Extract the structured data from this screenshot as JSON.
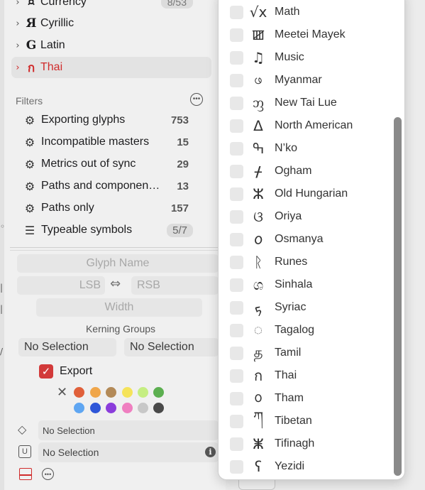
{
  "categories": [
    {
      "icon": "¤",
      "label": "Currency",
      "count": "8/53"
    },
    {
      "icon": "Я",
      "label": "Cyrillic"
    },
    {
      "icon": "G",
      "label": "Latin"
    },
    {
      "icon": "ก",
      "label": "Thai"
    }
  ],
  "filters": {
    "title": "Filters",
    "items": [
      {
        "label": "Exporting glyphs",
        "count": "753"
      },
      {
        "label": "Incompatible masters",
        "count": "15"
      },
      {
        "label": "Metrics out of sync",
        "count": "29"
      },
      {
        "label": "Paths and componen…",
        "count": "13"
      },
      {
        "label": "Paths only",
        "count": "157"
      },
      {
        "label": "Typeable symbols",
        "count": "5/7"
      }
    ]
  },
  "glyph_info": {
    "glyph_name_placeholder": "Glyph Name",
    "lsb_placeholder": "LSB",
    "rsb_placeholder": "RSB",
    "width_placeholder": "Width",
    "kerning_title": "Kerning Groups",
    "kerning_left": "No Selection",
    "kerning_right": "No Selection",
    "export_label": "Export",
    "tags_value": "No Selection",
    "unicode_value": "No Selection"
  },
  "colors": {
    "accent": "#d02b2b",
    "swatches": [
      "#e0603a",
      "#f0a64a",
      "#b38a58",
      "#f5e35a",
      "#c5ee82",
      "#5caf50",
      "#5fa6f2",
      "#2e56d8",
      "#8b3ddb",
      "#ef7fc0",
      "#c8c8c8",
      "#4a4a4a"
    ]
  },
  "scripts": [
    {
      "glyph": "√x",
      "label": "Math"
    },
    {
      "glyph": "ꯀ",
      "label": "Meetei Mayek"
    },
    {
      "glyph": "♫",
      "label": "Music"
    },
    {
      "glyph": "ဖ",
      "label": "Myanmar"
    },
    {
      "glyph": "ᦀ",
      "label": "New Tai Lue"
    },
    {
      "glyph": "ᐃ",
      "label": "North American"
    },
    {
      "glyph": "ߒ",
      "label": "N’ko"
    },
    {
      "glyph": "ᚋ",
      "label": "Ogham"
    },
    {
      "glyph": "ⵣ",
      "label": "Old Hungarian"
    },
    {
      "glyph": "ଓ",
      "label": "Oriya"
    },
    {
      "glyph": "𐒆",
      "label": "Osmanya"
    },
    {
      "glyph": "ᚱ",
      "label": "Runes"
    },
    {
      "glyph": "ශ",
      "label": "Sinhala"
    },
    {
      "glyph": "ܟ",
      "label": "Syriac"
    },
    {
      "glyph": "ᜀ",
      "label": "Tagalog"
    },
    {
      "glyph": "த",
      "label": "Tamil"
    },
    {
      "glyph": "ก",
      "label": "Thai"
    },
    {
      "glyph": "ᩅ",
      "label": "Tham"
    },
    {
      "glyph": "ཀ",
      "label": "Tibetan"
    },
    {
      "glyph": "ⵥ",
      "label": "Tifinagh"
    },
    {
      "glyph": "ʕ",
      "label": "Yezidi"
    }
  ]
}
